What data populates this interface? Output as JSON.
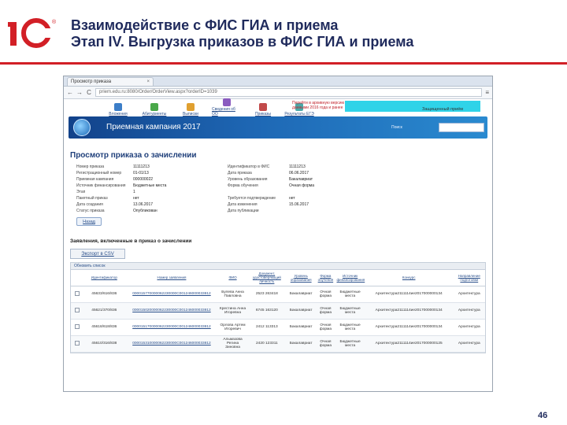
{
  "slide": {
    "title_line1": "Взаимодействие с ФИС ГИА и приема",
    "title_line2": "Этап IV. Выгрузка приказов в ФИС ГИА и приема",
    "page_number": "46",
    "accent_color": "#d21f26",
    "title_color": "#1f2a5c"
  },
  "logo": {
    "text": "1С",
    "mark": "®"
  },
  "browser": {
    "tab_title": "Просмотр приказа",
    "tab_close": "×",
    "back_icon": "←",
    "forward_icon": "→",
    "reload_icon": "C",
    "menu_icon": "≡",
    "url": "priem.edu.ru:8080/Order/OrderView.aspx?orderID=1039"
  },
  "site": {
    "menu_items": [
      {
        "label": "Вложения",
        "color": "#3c7ec8"
      },
      {
        "label": "Абитуриенты",
        "color": "#4aa84a"
      },
      {
        "label": "Выписки",
        "color": "#e0a030"
      },
      {
        "label": "Сведения об ОО",
        "color": "#8a5bbf"
      },
      {
        "label": "Приказы",
        "color": "#c24a4a"
      },
      {
        "label": "Результаты ЕГЭ",
        "color": "#4aa8a8"
      }
    ],
    "notice": "Перейти в архивную версию системы с данными 2016 года и ранее",
    "cabinet": "Защищенный приём",
    "banner_text": "Приемная кампания 2017",
    "banner_search_label": "Поиск",
    "accent_banner": "#1e68b5"
  },
  "order": {
    "heading": "Просмотр приказа о зачислении",
    "fields": [
      {
        "label": "Номер приказа",
        "value": "11111213",
        "label2": "Идентификатор в ФИС",
        "value2": "11111213"
      },
      {
        "label": "Регистрационный номер",
        "value": "01-01/13",
        "label2": "Дата приказа",
        "value2": "06.06.2017"
      },
      {
        "label": "Приемная кампания",
        "value": "000000022",
        "label2": "Уровень образования",
        "value2": "Бакалавриат"
      },
      {
        "label": "Источник финансирования",
        "value": "Бюджетные места",
        "label2": "Форма обучения",
        "value2": "Очная форма"
      },
      {
        "label": "Этап",
        "value": "1",
        "label2": "",
        "value2": ""
      },
      {
        "label": "Пакетный приказ",
        "value": "нет",
        "label2": "Требуется подтверждение",
        "value2": "нет"
      },
      {
        "label": "Дата создания",
        "value": "13.06.2017",
        "label2": "Дата изменения",
        "value2": "15.06.2017"
      },
      {
        "label": "Статус приказа",
        "value": "Опубликован",
        "label2": "Дата публикации",
        "value2": ""
      }
    ],
    "back_label": "Назад"
  },
  "apps": {
    "heading": "Заявления, включенные в приказ о зачислении",
    "csv_label": "Экспорт в CSV",
    "toolbar_label": "Обновить список",
    "columns": [
      "",
      "Идентификатор",
      "Номер заявления",
      "ФИО",
      "Документ, удостоверяющий личность",
      "Уровень образования",
      "Форма обучения",
      "Источник финансирования",
      "Конкурс",
      "Направление подготовки"
    ],
    "rows": [
      {
        "id": "45633/616/836",
        "num": "000015770000062230000C001246000033812",
        "fio": "Булева Анна Павловна",
        "doc": "2523 263418",
        "level": "Бакалавриат",
        "form": "Очная форма",
        "fin": "Бюджетные места",
        "comp": "Архитектура2111114ие2017000000134",
        "dir": "Архитектура"
      },
      {
        "id": "45621/370/836",
        "num": "000015020000062230000C001246000033812",
        "fio": "Крестина Анна Игоревна",
        "doc": "6745 163120",
        "level": "Бакалавриат",
        "form": "Очная форма",
        "fin": "Бюджетные места",
        "comp": "Архитектура2111114ие2017000000134",
        "dir": "Архитектура"
      },
      {
        "id": "45618/618/836",
        "num": "000015170000062230000C001246000033812",
        "fio": "Орлова Артем Игоревич",
        "doc": "2412 113313",
        "level": "Бакалавриат",
        "form": "Очная форма",
        "fin": "Бюджетные места",
        "comp": "Архитектура2111114ие2017000000134",
        "dir": "Архитектура"
      },
      {
        "id": "45610/316/838",
        "num": "000015310000062230000C001246000033812",
        "fio": "Альмазова Регина Зиновна",
        "doc": "2420 123311",
        "level": "Бакалавриат",
        "form": "Очная форма",
        "fin": "Бюджетные места",
        "comp": "Архитектура2111114ие2017000000125",
        "dir": "Архитектура"
      }
    ]
  }
}
